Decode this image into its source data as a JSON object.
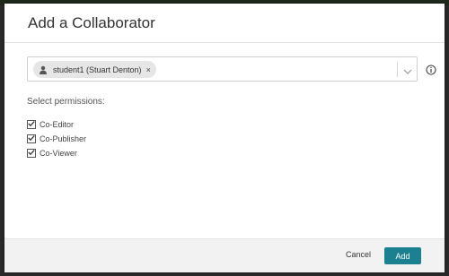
{
  "dialog": {
    "title": "Add a Collaborator"
  },
  "collaborator_select": {
    "selected_chip": "student1 (Stuart Denton)",
    "remove_glyph": "×",
    "chip_icon": "user-icon",
    "dropdown_icon": "chevron-down-icon",
    "info_icon": "info-icon"
  },
  "permissions": {
    "label": "Select permissions:",
    "items": [
      {
        "label": "Co-Editor",
        "checked": true
      },
      {
        "label": "Co-Publisher",
        "checked": true
      },
      {
        "label": "Co-Viewer",
        "checked": true
      }
    ]
  },
  "footer": {
    "cancel_label": "Cancel",
    "add_label": "Add"
  },
  "colors": {
    "primary_button": "#1b8191",
    "footer_bg": "#f2f2f2",
    "chip_bg": "#e6e6e6"
  }
}
